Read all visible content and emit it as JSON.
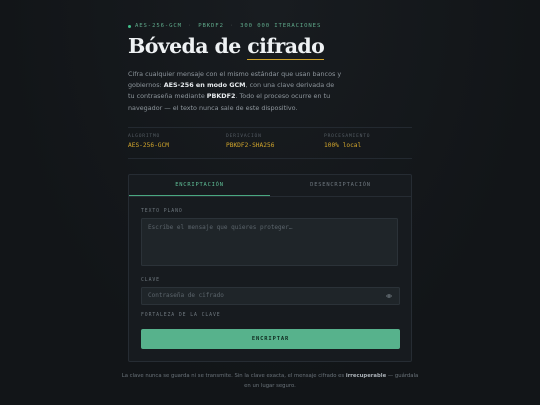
{
  "header": {
    "eyebrow": [
      "AES-256-GCM",
      "PBKDF2",
      "300 000 ITERACIONES"
    ],
    "title_prefix": "Bóveda de ",
    "title_highlight": "cifrado",
    "lede": {
      "p1": "Cifra cualquier mensaje con el mismo estándar que usan bancos y gobiernos: ",
      "b1": "AES-256 en modo GCM",
      "p2": ", con una clave derivada de tu contraseña mediante ",
      "b2": "PBKDF2",
      "p3": ". Todo el proceso ocurre en tu navegador — el texto nunca sale de este dispositivo."
    }
  },
  "stats": [
    {
      "label": "ALGORITMO",
      "value": "AES-256-GCM"
    },
    {
      "label": "DERIVACIÓN",
      "value": "PBKDF2-SHA256"
    },
    {
      "label": "PROCESAMIENTO",
      "value": "100% local"
    }
  ],
  "tabs": [
    {
      "label": "ENCRIPTACIÓN",
      "active": true
    },
    {
      "label": "DESENCRIPTACIÓN",
      "active": false
    }
  ],
  "form": {
    "plaintext_label": "TEXTO PLANO",
    "plaintext_placeholder": "Escribe el mensaje que quieres proteger…",
    "key_label": "CLAVE",
    "key_placeholder": "Contraseña de cifrado",
    "strength_label": "FORTALEZA DE LA CLAVE",
    "submit_label": "ENCRIPTAR"
  },
  "footer": {
    "p1": "La clave nunca se guarda ni se transmite. Sin la clave exacta, el mensaje cifrado es ",
    "b1": "irrecuperable",
    "p2": " — guárdala en un lugar seguro."
  },
  "colors": {
    "accent_green": "#57b28c",
    "accent_gold": "#d1a52c",
    "background": "#121518",
    "card": "#171b1f"
  },
  "icons": {
    "status_dot": "dot-icon",
    "password_toggle": "eye-icon"
  }
}
